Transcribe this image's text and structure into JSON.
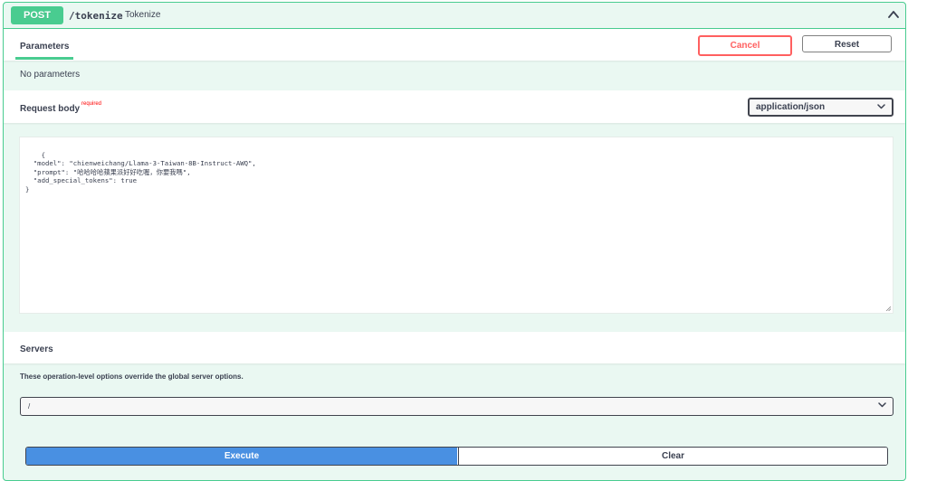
{
  "operation": {
    "method": "POST",
    "path": "/tokenize",
    "summary": "Tokenize"
  },
  "parameters": {
    "tab_label": "Parameters",
    "cancel_label": "Cancel",
    "reset_label": "Reset",
    "empty_text": "No parameters"
  },
  "request_body": {
    "title": "Request body",
    "required_label": "required",
    "content_type": "application/json",
    "code": "{\n  \"model\": \"chienweichang/Llama-3-Taiwan-8B-Instruct-AWQ\",\n  \"prompt\": \"哈哈哈哈蘋果派好好吃喔，你要我嗎\",\n  \"add_special_tokens\": true\n}"
  },
  "servers": {
    "title": "Servers",
    "note": "These operation-level options override the global server options.",
    "selected": "/"
  },
  "actions": {
    "execute_label": "Execute",
    "clear_label": "Clear"
  },
  "colors": {
    "post_green": "#49cc90",
    "post_bg": "#eaf8f2",
    "cancel_red": "#ff6060",
    "execute_blue": "#4990e2"
  },
  "icons": {
    "collapse": "chevron-up-icon",
    "select": "chevron-down-icon",
    "resize": "resize-grip-icon"
  }
}
